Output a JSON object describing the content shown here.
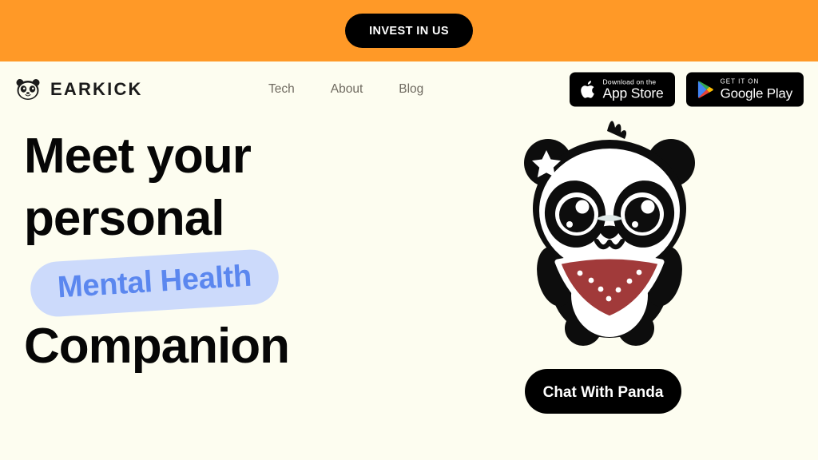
{
  "theme": {
    "banner_bg": "#ff9927",
    "page_bg": "#fdfdf0",
    "text_dark": "#060606",
    "nav_link": "#6f6a60",
    "highlight_pill_bg": "#ccdafb",
    "highlight_pill_text": "#5b87ef",
    "bandana_red": "#a13a3a",
    "button_bg": "#000000",
    "button_text": "#ffffff"
  },
  "announcement": {
    "cta_label": "INVEST IN US"
  },
  "nav": {
    "brand_name": "EARKICK",
    "brand_icon": "panda-head-icon",
    "links": [
      {
        "label": "Tech"
      },
      {
        "label": "About"
      },
      {
        "label": "Blog"
      }
    ],
    "badges": [
      {
        "icon": "apple-logo-icon",
        "small_label": "Download on the",
        "big_label": "App Store"
      },
      {
        "icon": "google-play-icon",
        "small_label": "GET IT ON",
        "big_label": "Google Play"
      }
    ]
  },
  "hero": {
    "headline_line_1": "Meet your",
    "headline_line_2": "personal",
    "highlight": "Mental Health",
    "headline_line_3": "Companion",
    "mascot_icon": "panda-mascot-illustration",
    "cta_label": "Chat With Panda"
  }
}
